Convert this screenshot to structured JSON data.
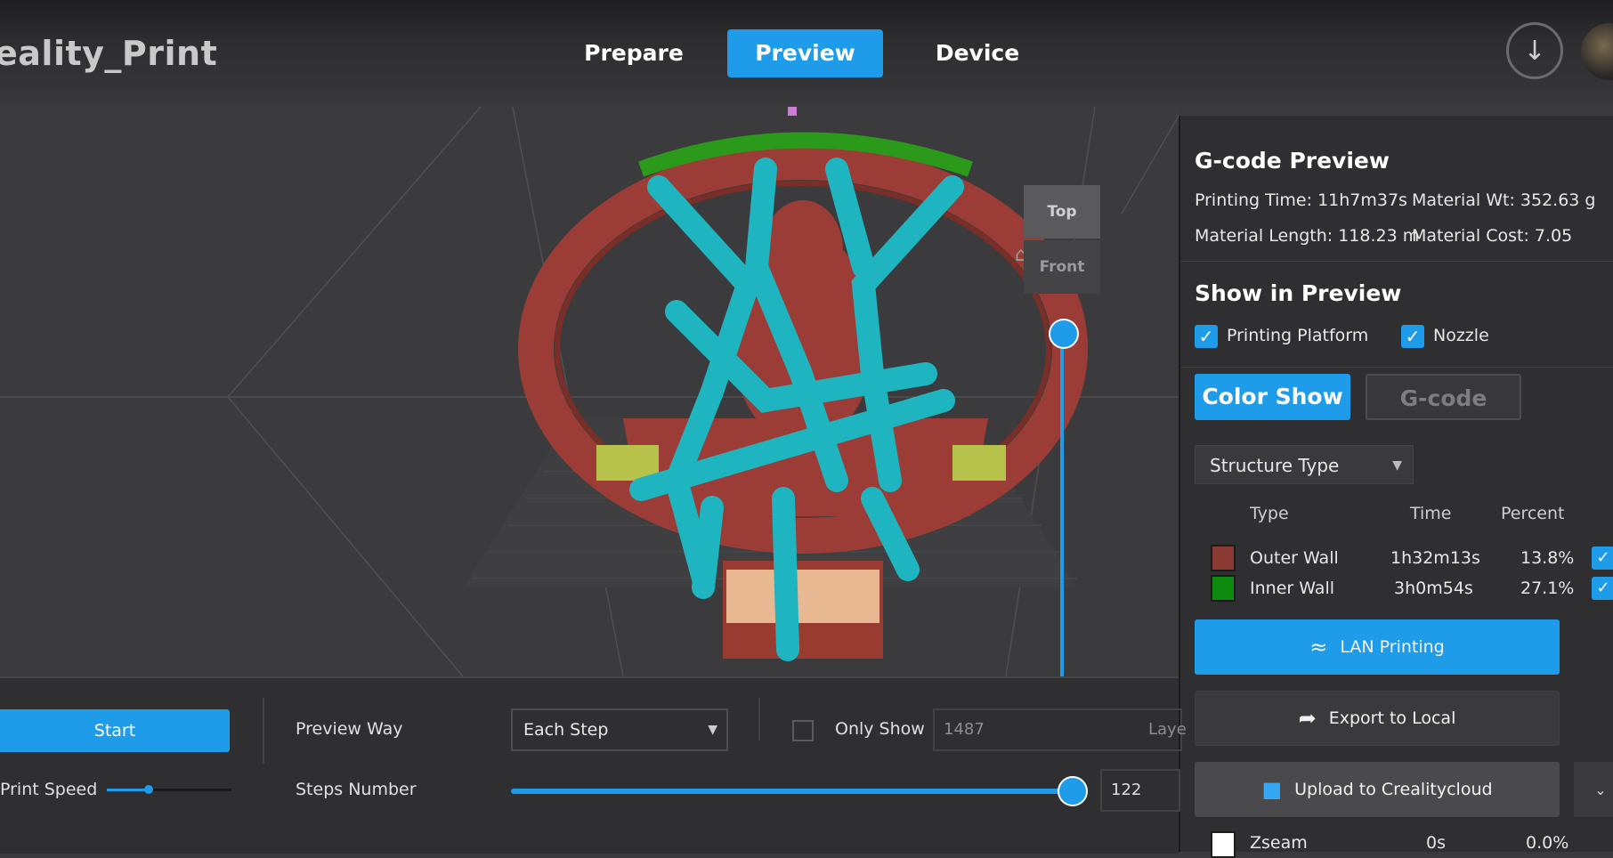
{
  "app": {
    "title": "eality_Print"
  },
  "nav": {
    "tabs": [
      {
        "label": "Prepare"
      },
      {
        "label": "Preview",
        "active": true
      },
      {
        "label": "Device"
      }
    ]
  },
  "header": {
    "download_icon": "download-icon",
    "avatar": "user-avatar"
  },
  "viewport": {
    "view_buttons": {
      "top": "Top",
      "front": "Front"
    },
    "home_icon": "home-icon"
  },
  "panel": {
    "title": "G-code Preview",
    "stats": {
      "printing_time": "Printing Time: 11h7m37s",
      "material_wt": "Material Wt: 352.63 g",
      "material_length": "Material Length: 118.23 m",
      "material_cost": "Material Cost: 7.05"
    },
    "show_title": "Show in Preview",
    "checks": {
      "platform": "Printing Platform",
      "nozzle": "Nozzle"
    },
    "toggle": {
      "color_show": "Color Show",
      "gcode": "G-code"
    },
    "structure_select": "Structure Type",
    "table": {
      "headers": [
        "Type",
        "Time",
        "Percent"
      ],
      "rows": [
        {
          "type": "Outer Wall",
          "time": "1h32m13s",
          "percent": "13.8%",
          "color": "#8b3a33"
        },
        {
          "type": "Inner Wall",
          "time": "3h0m54s",
          "percent": "27.1%",
          "color": "#0e8a0e"
        },
        {
          "type": "Zseam",
          "time": "0s",
          "percent": "0.0%",
          "color": "#ffffff"
        }
      ]
    },
    "actions": {
      "lan": "LAN Printing",
      "export": "Export to Local",
      "upload": "Upload to Crealitycloud"
    }
  },
  "bottom": {
    "start": "Start",
    "print_speed": "Print Speed",
    "preview_way_label": "Preview Way",
    "preview_way_value": "Each Step",
    "only_show": "Only Show",
    "only_show_value": "1487",
    "layer_hint": "Laye",
    "steps_label": "Steps Number",
    "steps_value": "122",
    "steps_fraction": 0.98
  },
  "colors": {
    "accent": "#1e9be9",
    "support": "#1fb5c0",
    "outer_wall": "#8b3a33",
    "infill": "#0e8a0e"
  }
}
